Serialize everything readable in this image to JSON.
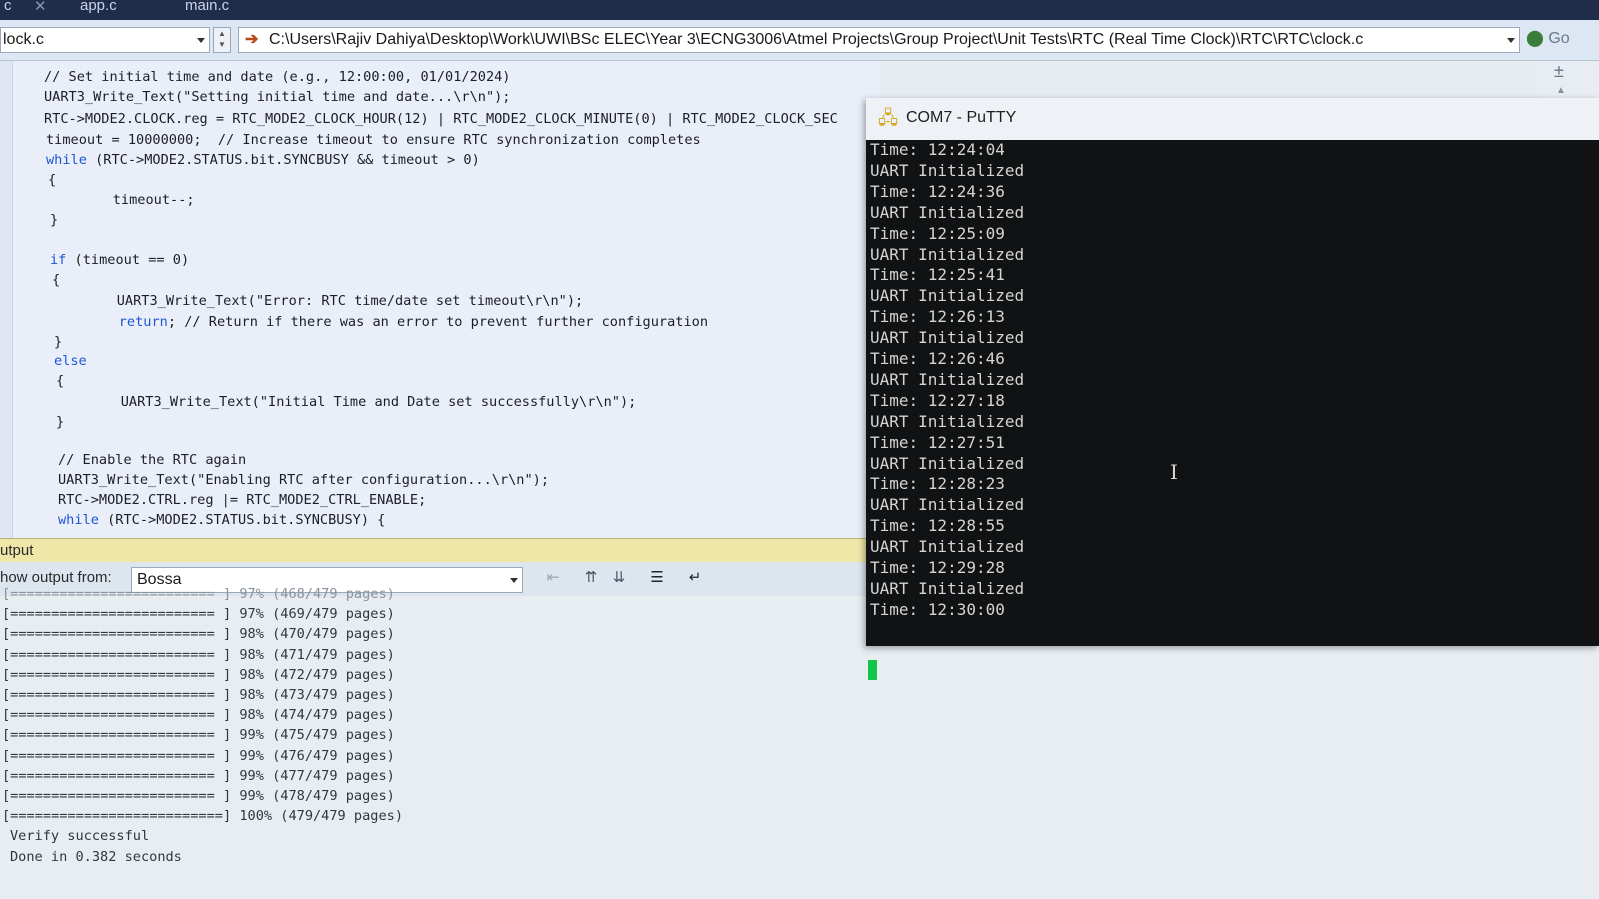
{
  "tabs": [
    {
      "label": "c"
    },
    {
      "label": "app.c"
    },
    {
      "label": "main.c"
    }
  ],
  "navbar": {
    "file_combo": "lock.c",
    "path": "C:\\Users\\Rajiv Dahiya\\Desktop\\Work\\UWI\\BSc ELEC\\Year 3\\ECNG3006\\Atmel Projects\\Group Project\\Unit Tests\\RTC (Real Time Clock)\\RTC\\RTC\\clock.c",
    "go_label": "Go"
  },
  "code": {
    "lines": [
      {
        "pre": "// Set initial time and date (e.g., 12:00:00, 01/01/2024)",
        "kw": "",
        "post": ""
      },
      {
        "pre": "UART3_Write_Text(\"Setting initial time and date...\\r\\n\");",
        "kw": "",
        "post": ""
      },
      {
        "pre": "RTC->MODE2.CLOCK.reg = RTC_MODE2_CLOCK_HOUR(12) | RTC_MODE2_CLOCK_MINUTE(0) | RTC_MODE2_CLOCK_SEC",
        "kw": "",
        "post": ""
      },
      {
        "pre": "timeout = 10000000;  // Increase timeout to ensure RTC synchronization completes",
        "kw": "",
        "post": ""
      },
      {
        "pre": "",
        "kw": "while",
        "post": " (RTC->MODE2.STATUS.bit.SYNCBUSY && timeout > 0)"
      },
      {
        "pre": "{",
        "kw": "",
        "post": ""
      },
      {
        "pre": "    timeout--;",
        "kw": "",
        "post": ""
      },
      {
        "pre": "}",
        "kw": "",
        "post": ""
      },
      {
        "pre": "",
        "kw": "if",
        "post": " (timeout == 0)"
      },
      {
        "pre": "{",
        "kw": "",
        "post": ""
      },
      {
        "pre": "    UART3_Write_Text(\"Error: RTC time/date set timeout\\r\\n\");",
        "kw": "",
        "post": ""
      },
      {
        "pre": "    ",
        "kw": "return",
        "post": "; // Return if there was an error to prevent further configuration"
      },
      {
        "pre": "}",
        "kw": "",
        "post": ""
      },
      {
        "pre": "",
        "kw": "else",
        "post": ""
      },
      {
        "pre": "{",
        "kw": "",
        "post": ""
      },
      {
        "pre": "    UART3_Write_Text(\"Initial Time and Date set successfully\\r\\n\");",
        "kw": "",
        "post": ""
      },
      {
        "pre": "}",
        "kw": "",
        "post": ""
      },
      {
        "pre": "// Enable the RTC again",
        "kw": "",
        "post": ""
      },
      {
        "pre": "UART3_Write_Text(\"Enabling RTC after configuration...\\r\\n\");",
        "kw": "",
        "post": ""
      },
      {
        "pre": "RTC->MODE2.CTRL.reg |= RTC_MODE2_CTRL_ENABLE;",
        "kw": "",
        "post": ""
      },
      {
        "pre": "",
        "kw": "while",
        "post": " (RTC->MODE2.STATUS.bit.SYNCBUSY) {"
      }
    ]
  },
  "output": {
    "header": "utput",
    "show_label": "how output from:",
    "source": "Bossa",
    "lines": [
      "[========================= ] 97% (468/479 pages)",
      "[========================= ] 97% (469/479 pages)",
      "[========================= ] 98% (470/479 pages)",
      "[========================= ] 98% (471/479 pages)",
      "[========================= ] 98% (472/479 pages)",
      "[========================= ] 98% (473/479 pages)",
      "[========================= ] 98% (474/479 pages)",
      "[========================= ] 99% (475/479 pages)",
      "[========================= ] 99% (476/479 pages)",
      "[========================= ] 99% (477/479 pages)",
      "[========================= ] 99% (478/479 pages)",
      "[==========================] 100% (479/479 pages)",
      "Verify successful",
      "Done in 0.382 seconds"
    ]
  },
  "putty": {
    "title": "COM7 - PuTTY",
    "lines": [
      "Time: 12:24:04",
      "UART Initialized",
      "Time: 12:24:36",
      "UART Initialized",
      "Time: 12:25:09",
      "UART Initialized",
      "Time: 12:25:41",
      "UART Initialized",
      "Time: 12:26:13",
      "UART Initialized",
      "Time: 12:26:46",
      "UART Initialized",
      "Time: 12:27:18",
      "UART Initialized",
      "Time: 12:27:51",
      "UART Initialized",
      "Time: 12:28:23",
      "UART Initialized",
      "Time: 12:28:55",
      "UART Initialized",
      "Time: 12:29:28",
      "UART Initialized",
      "Time: 12:30:00"
    ],
    "cursor_color": "#12c64a"
  },
  "colors": {
    "keyword": "#1f56d8",
    "output_header_bg": "#efe6a8",
    "terminal_bg": "#101213"
  }
}
